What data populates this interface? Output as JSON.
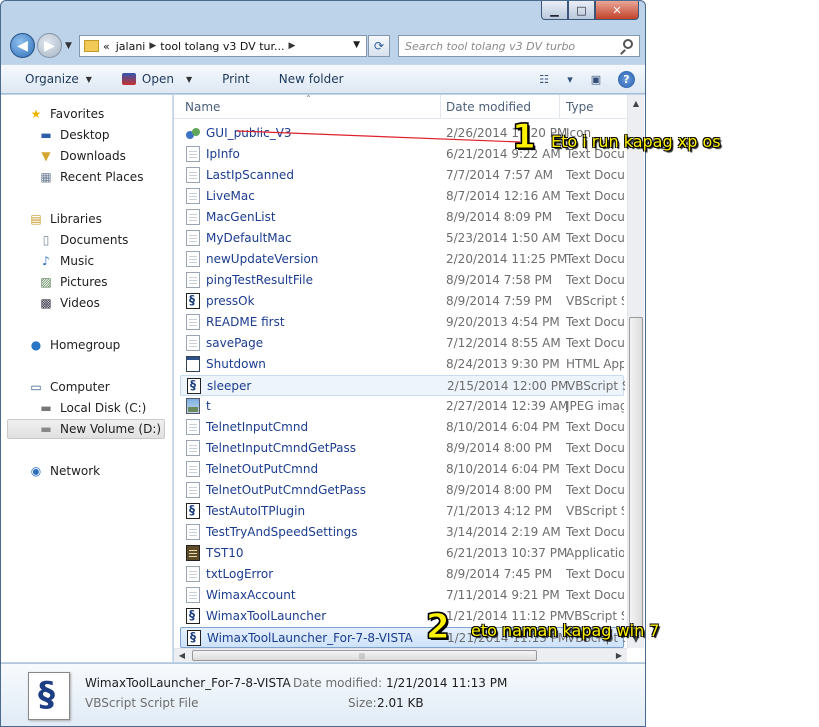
{
  "window": {
    "controls": {
      "minimize": "▁",
      "maximize": "□",
      "close": "✕"
    }
  },
  "nav": {
    "breadcrumb": [
      "«",
      "jalani",
      "tool tolang v3 DV tur..."
    ],
    "search_placeholder": "Search tool tolang v3 DV turbo"
  },
  "toolbar": {
    "organize": "Organize",
    "open": "Open",
    "print": "Print",
    "new_folder": "New folder"
  },
  "sidebar": {
    "favorites": "Favorites",
    "desktop": "Desktop",
    "downloads": "Downloads",
    "recent_places": "Recent Places",
    "libraries": "Libraries",
    "documents": "Documents",
    "music": "Music",
    "pictures": "Pictures",
    "videos": "Videos",
    "homegroup": "Homegroup",
    "computer": "Computer",
    "local_disk": "Local Disk (C:)",
    "new_volume": "New Volume (D:)",
    "network": "Network"
  },
  "columns": {
    "name": "Name",
    "date": "Date modified",
    "type": "Type"
  },
  "files": [
    {
      "name": "GUI_public_V3",
      "date": "2/26/2014 11:20 PM",
      "type": "Icon",
      "icon": "gui"
    },
    {
      "name": "IpInfo",
      "date": "6/21/2014 9:22 AM",
      "type": "Text Document",
      "icon": "txt"
    },
    {
      "name": "LastIpScanned",
      "date": "7/7/2014 7:57 AM",
      "type": "Text Document",
      "icon": "txt"
    },
    {
      "name": "LiveMac",
      "date": "8/7/2014 12:16 AM",
      "type": "Text Document",
      "icon": "txt"
    },
    {
      "name": "MacGenList",
      "date": "8/9/2014 8:09 PM",
      "type": "Text Document",
      "icon": "txt"
    },
    {
      "name": "MyDefaultMac",
      "date": "5/23/2014 1:50 AM",
      "type": "Text Document",
      "icon": "txt"
    },
    {
      "name": "newUpdateVersion",
      "date": "2/20/2014 11:25 PM",
      "type": "Text Document",
      "icon": "txt"
    },
    {
      "name": "pingTestResultFile",
      "date": "8/9/2014 7:58 PM",
      "type": "Text Document",
      "icon": "txt"
    },
    {
      "name": "pressOk",
      "date": "8/9/2014 7:59 PM",
      "type": "VBScript Script File",
      "icon": "vbs"
    },
    {
      "name": "README first",
      "date": "9/20/2013 4:54 PM",
      "type": "Text Document",
      "icon": "txt"
    },
    {
      "name": "savePage",
      "date": "7/12/2014 8:55 AM",
      "type": "Text Document",
      "icon": "txt"
    },
    {
      "name": "Shutdown",
      "date": "8/24/2013 9:30 PM",
      "type": "HTML Application",
      "icon": "html"
    },
    {
      "name": "sleeper",
      "date": "2/15/2014 12:00 PM",
      "type": "VBScript Script File",
      "icon": "vbs"
    },
    {
      "name": "t",
      "date": "2/27/2014 12:39 AM",
      "type": "JPEG image",
      "icon": "jpg"
    },
    {
      "name": "TelnetInputCmnd",
      "date": "8/10/2014 6:04 PM",
      "type": "Text Document",
      "icon": "txt"
    },
    {
      "name": "TelnetInputCmndGetPass",
      "date": "8/9/2014 8:00 PM",
      "type": "Text Document",
      "icon": "txt"
    },
    {
      "name": "TelnetOutPutCmnd",
      "date": "8/10/2014 6:04 PM",
      "type": "Text Document",
      "icon": "txt"
    },
    {
      "name": "TelnetOutPutCmndGetPass",
      "date": "8/9/2014 8:00 PM",
      "type": "Text Document",
      "icon": "txt"
    },
    {
      "name": "TestAutoITPlugin",
      "date": "7/1/2013 4:12 PM",
      "type": "VBScript Script File",
      "icon": "vbs"
    },
    {
      "name": "TestTryAndSpeedSettings",
      "date": "3/14/2014 2:19 AM",
      "type": "Text Document",
      "icon": "txt"
    },
    {
      "name": "TST10",
      "date": "6/21/2013 10:37 PM",
      "type": "Application",
      "icon": "app"
    },
    {
      "name": "txtLogError",
      "date": "8/9/2014 7:45 PM",
      "type": "Text Document",
      "icon": "txt"
    },
    {
      "name": "WimaxAccount",
      "date": "7/11/2014 9:21 PM",
      "type": "Text Document",
      "icon": "txt"
    },
    {
      "name": "WimaxToolLauncher",
      "date": "1/21/2014 11:12 PM",
      "type": "VBScript Script File",
      "icon": "vbs"
    },
    {
      "name": "WimaxToolLauncher_For-7-8-VISTA",
      "date": "1/21/2014 11:13 PM",
      "type": "VBScript Script File",
      "icon": "vbs"
    }
  ],
  "details": {
    "name": "WimaxToolLauncher_For-7-8-VISTA",
    "kind": "VBScript Script File",
    "date_label": "Date modified:",
    "date": "1/21/2014 11:13 PM",
    "size_label": "Size:",
    "size": "2.01 KB"
  },
  "annotations": [
    {
      "number": "1",
      "text": "Eto i run kapag xp os"
    },
    {
      "number": "2",
      "text": "eto naman kapag win 7"
    }
  ],
  "colors": {
    "annotation": "#fff200",
    "line": "#e0202a",
    "link_text": "#1b3c8f"
  }
}
